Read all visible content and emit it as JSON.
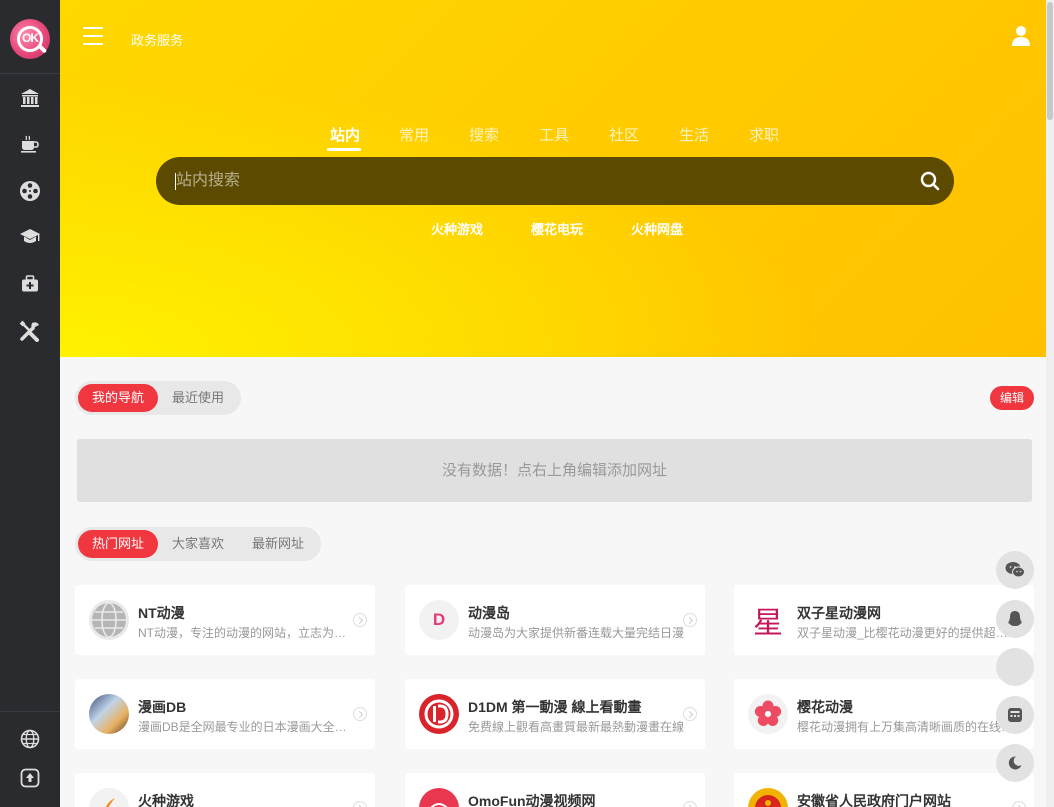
{
  "sidebar": {
    "logo_text": "OK",
    "items": [
      {
        "icon": "building-icon"
      },
      {
        "icon": "coffee-icon"
      },
      {
        "icon": "film-reel-icon"
      },
      {
        "icon": "graduation-cap-icon"
      },
      {
        "icon": "medical-kit-icon"
      },
      {
        "icon": "tools-icon"
      }
    ],
    "bottom_items": [
      {
        "icon": "globe-icon"
      },
      {
        "icon": "upload-icon"
      }
    ]
  },
  "header": {
    "link": "政务服务"
  },
  "search": {
    "tabs": [
      "站内",
      "常用",
      "搜索",
      "工具",
      "社区",
      "生活",
      "求职"
    ],
    "active_tab": "站内",
    "placeholder": "站内搜索",
    "quick_links": [
      "火种游戏",
      "樱花电玩",
      "火种网盘"
    ]
  },
  "my_nav": {
    "tabs": [
      "我的导航",
      "最近使用"
    ],
    "edit_label": "编辑",
    "empty_text": "没有数据！点右上角编辑添加网址"
  },
  "hot": {
    "tabs": [
      "热门网址",
      "大家喜欢",
      "最新网址"
    ],
    "cards": [
      {
        "title": "NT动漫",
        "desc": "NT动漫，专注的动漫的网站，立志为广大动漫爱好者提供"
      },
      {
        "title": "动漫岛",
        "desc": "动漫岛为大家提供新番连载大量完结日漫"
      },
      {
        "title": "双子星动漫网",
        "desc": "双子星动漫_比樱花动漫更好的提供超清动漫"
      },
      {
        "title": "漫画DB",
        "desc": "漫画DB是全网最专业的日本漫画大全资源"
      },
      {
        "title": "D1DM 第一動漫 線上看動畫",
        "desc": "免费線上觀看高畫質最新最熱動漫畫在線"
      },
      {
        "title": "樱花动漫",
        "desc": "樱花动漫拥有上万集高清晰画质的在线动漫"
      },
      {
        "title": "火种游戏",
        "desc": ""
      },
      {
        "title": "OmoFun动漫视频网",
        "desc": ""
      },
      {
        "title": "安徽省人民政府门户网站",
        "desc": ""
      }
    ],
    "card_avatar_letters": {
      "d": "D",
      "star": "星"
    }
  },
  "float_buttons": [
    "wechat-icon",
    "qq-icon",
    "blank",
    "calculator-icon",
    "moon-icon"
  ],
  "colors": {
    "accent": "#f0373f",
    "sidebar": "#2a2b2f",
    "hero": "#ffd000"
  }
}
